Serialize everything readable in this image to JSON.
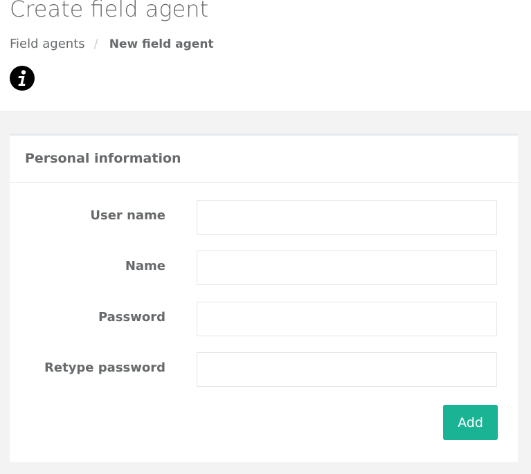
{
  "header": {
    "title": "Create field agent",
    "breadcrumb": {
      "parent": "Field agents",
      "separator": "/",
      "current": "New field agent"
    },
    "info_icon": "info-circle-icon"
  },
  "panel": {
    "title": "Personal information",
    "fields": [
      {
        "label": "User name",
        "value": "",
        "placeholder": ""
      },
      {
        "label": "Name",
        "value": "",
        "placeholder": ""
      },
      {
        "label": "Password",
        "value": "",
        "placeholder": ""
      },
      {
        "label": "Retype password",
        "value": "",
        "placeholder": ""
      }
    ],
    "submit_label": "Add"
  },
  "colors": {
    "primary": "#1ab394",
    "text": "#676a6c",
    "page_background": "#f3f3f3",
    "panel_background": "#ffffff",
    "border": "#e7eaec"
  }
}
